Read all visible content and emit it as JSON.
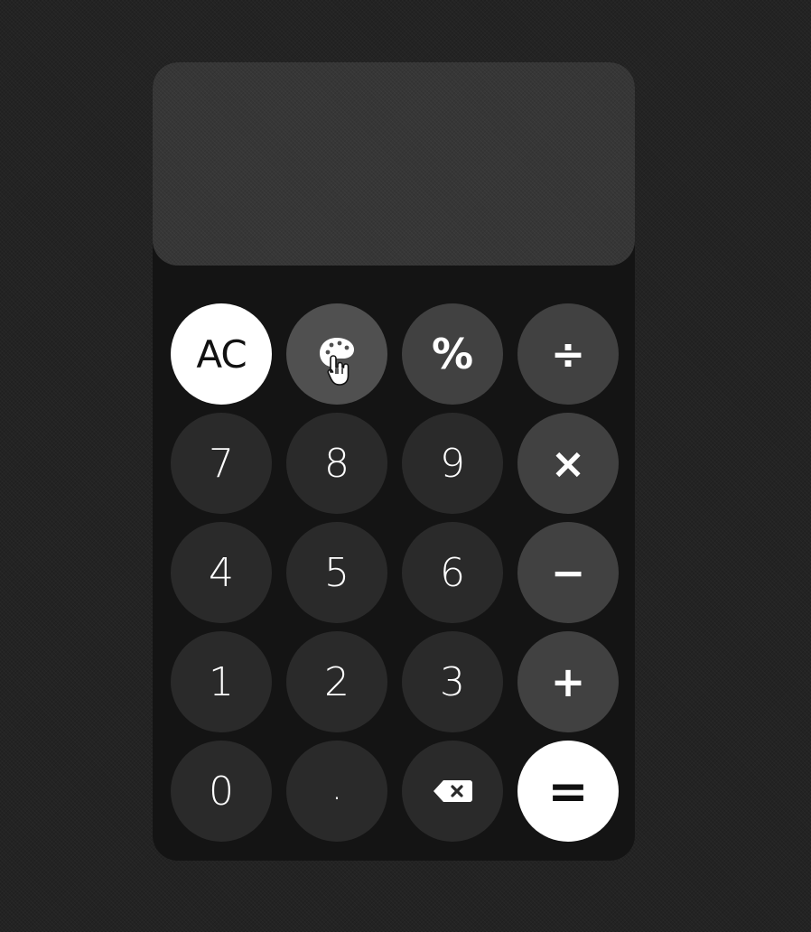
{
  "display": {
    "expression": "",
    "result": ""
  },
  "keys": {
    "clear": "AC",
    "percent": "%",
    "divide": "÷",
    "seven": "7",
    "eight": "8",
    "nine": "9",
    "multiply": "×",
    "four": "4",
    "five": "5",
    "six": "6",
    "minus": "−",
    "one": "1",
    "two": "2",
    "three": "3",
    "plus": "+",
    "zero": "0",
    "decimal": ".",
    "equals": "="
  },
  "icons": {
    "theme": "palette-icon",
    "cursor": "hand-pointer-icon",
    "backspace": "backspace-icon"
  },
  "colors": {
    "page_background": "#232323",
    "panel_background": "#141414",
    "display_background": "#363636",
    "digit_key": "#2a2a2a",
    "operator_key": "#414141",
    "theme_key": "#505050",
    "accent_key": "#ffffff"
  }
}
